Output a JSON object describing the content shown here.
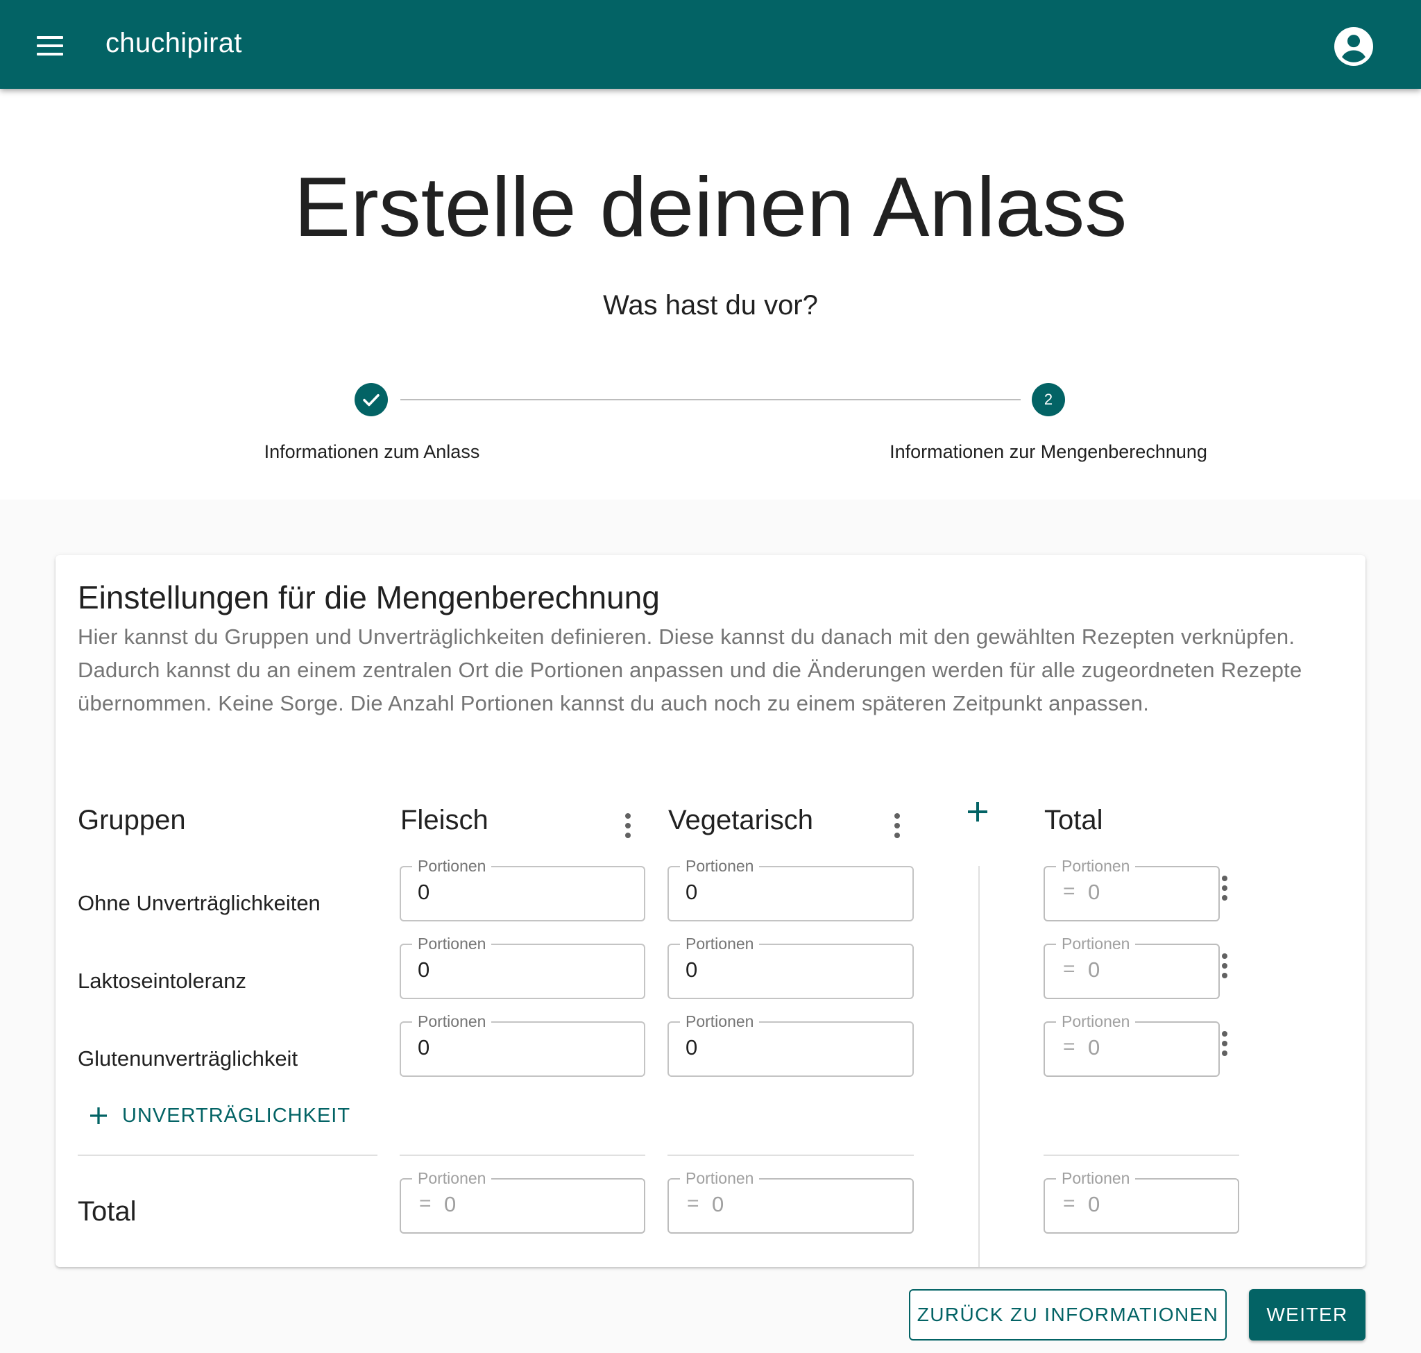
{
  "appbar": {
    "title": "chuchipirat",
    "menu_icon": "menu-icon",
    "account_icon": "account-circle-icon",
    "color": "#036365"
  },
  "hero": {
    "title": "Erstelle deinen Anlass",
    "subtitle": "Was hast du vor?"
  },
  "stepper": {
    "steps": [
      {
        "label": "Informationen zum Anlass",
        "state": "completed"
      },
      {
        "label": "Informationen zur Mengenberechnung",
        "state": "active",
        "number": "2"
      }
    ]
  },
  "card": {
    "title": "Einstellungen für die Mengenberechnung",
    "description": "Hier kannst du Gruppen und Unverträglichkeiten definieren. Diese kannst du danach mit den gewählten Rezepten verknüpfen. Dadurch kannst du an einem zentralen Ort die Portionen anpassen und die Änderungen werden für alle zugeordneten Rezepte übernommen. Keine Sorge. Die Anzahl Portionen kannst du auch noch zu einem späteren Zeitpunkt anpassen."
  },
  "table": {
    "groups_header": "Gruppen",
    "columns": [
      {
        "name": "Fleisch"
      },
      {
        "name": "Vegetarisch"
      }
    ],
    "total_header": "Total",
    "field_label": "Portionen",
    "rows": [
      {
        "label": "Ohne Unverträglichkeiten",
        "values": [
          "0",
          "0"
        ],
        "total": "0"
      },
      {
        "label": "Laktoseintoleranz",
        "values": [
          "0",
          "0"
        ],
        "total": "0"
      },
      {
        "label": "Glutenunverträglichkeit",
        "values": [
          "0",
          "0"
        ],
        "total": "0"
      }
    ],
    "add_intolerance_label": "UNVERTRÄGLICHKEIT",
    "total_row": {
      "label": "Total",
      "values": [
        "0",
        "0"
      ],
      "total": "0"
    },
    "eq_symbol": "="
  },
  "actions": {
    "back_label": "ZURÜCK ZU INFORMATIONEN",
    "next_label": "WEITER"
  }
}
